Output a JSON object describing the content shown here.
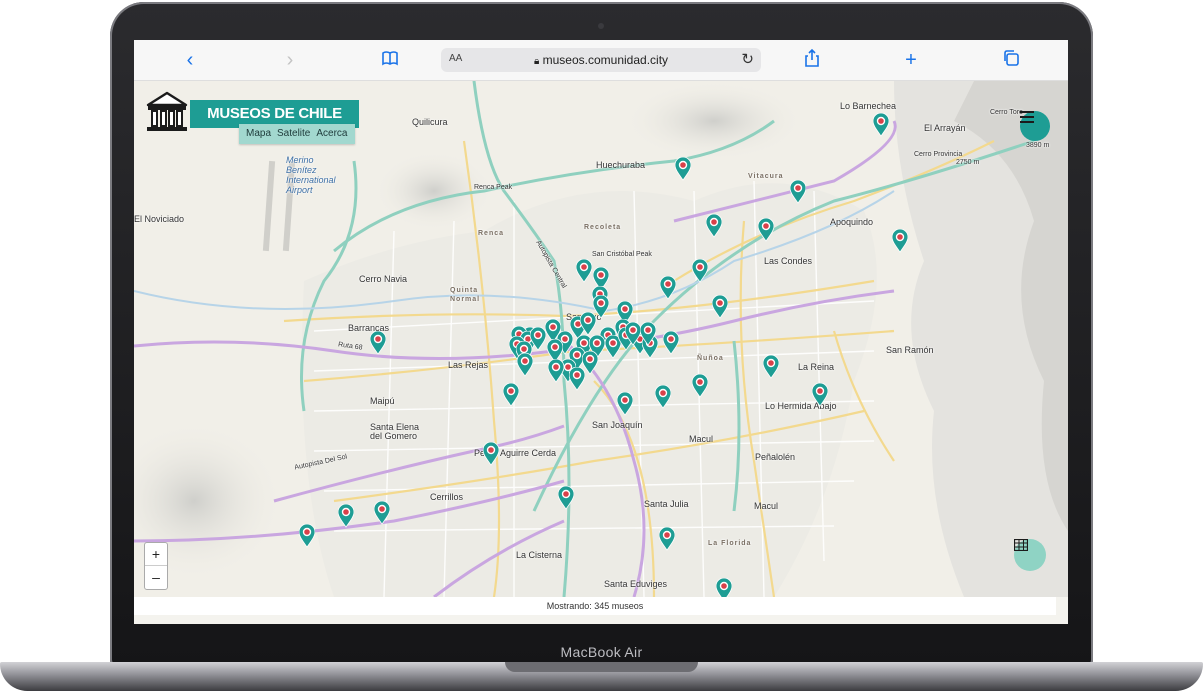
{
  "device": {
    "model_label": "MacBook Air"
  },
  "browser": {
    "aa_label": "AA",
    "url": "museos.comunidad.city"
  },
  "app": {
    "title": "MUSEOS DE CHILE",
    "tabs": [
      {
        "label": "Mapa"
      },
      {
        "label": "Satelite"
      },
      {
        "label": "Acerca"
      }
    ],
    "status": "Mostrando: 345 museos"
  },
  "map": {
    "zoom_in_label": "+",
    "zoom_out_label": "–",
    "places": [
      "Lo Barnechea",
      "El Arrayán",
      "Cerro Toro",
      "3890 m",
      "Cerro Provincia",
      "2750 m",
      "Quilicura",
      "Huechuraba",
      "Vitacura",
      "Apoquindo",
      "Renca Peak",
      "Renca",
      "Recoleta",
      "San Cristóbal Peak",
      "Las Condes",
      "El Noviciado",
      "Cerro Navia",
      "Quinta",
      "Normal",
      "Barrancas",
      "Ruta 68",
      "Santiago",
      "Las Rejas",
      "Ñuñoa",
      "La Reina",
      "San Ramón",
      "Maipú",
      "San Joaquín",
      "Lo Hermida Abajo",
      "Santa Elena",
      "del Gomero",
      "Pedro Aguirre Cerda",
      "Macul",
      "Peñalolén",
      "Cerrillos",
      "Santa Julia",
      "Macul",
      "La Cisterna",
      "La Florida",
      "Santa Eduviges",
      "Autopista Central",
      "Autopista Del Sol",
      "Merino",
      "Benítez",
      "International",
      "Airport",
      "Maipú"
    ],
    "colors": {
      "pin": "#1e9d94",
      "pin_dot": "#d9414a",
      "brand": "#1e9d94"
    }
  }
}
